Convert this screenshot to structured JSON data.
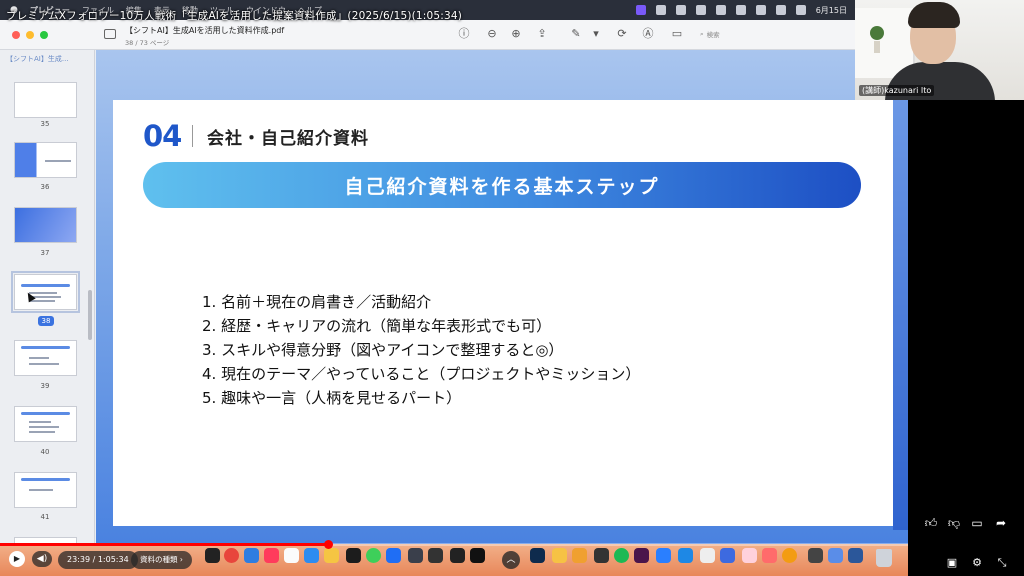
{
  "video": {
    "title": "プレミアムXフォロワー10万人戦術「生成AIを活用した提案資料作成」(2025/6/15)(1:05:34)",
    "current_time": "23:39",
    "duration": "1:05:34",
    "time_separator": " / ",
    "chapter_label": "資料の種類 ›",
    "progress_fraction": 0.361
  },
  "menubar": {
    "app": "プレビュー",
    "items": [
      "ファイル",
      "編集",
      "表示",
      "移動",
      "ツール",
      "ウインドウ",
      "ヘルプ"
    ],
    "clock": "6月15日"
  },
  "window": {
    "doc_title": "【シフトAI】生成AIを活用した資料作成.pdf",
    "page_indicator": "38 / 73 ページ",
    "search_placeholder": "検索",
    "traffic_colors": [
      "#ff5f57",
      "#febc2e",
      "#28c840"
    ]
  },
  "sidebar": {
    "header": "【シフトAI】生成...",
    "pages": [
      "35",
      "36",
      "37",
      "38",
      "39",
      "40",
      "41"
    ],
    "selected_page": "38"
  },
  "slide": {
    "number": "04",
    "heading": "会社・自己紹介資料",
    "banner": "自己紹介資料を作る基本ステップ",
    "steps": [
      "1. 名前＋現在の肩書き／活動紹介",
      "2. 経歴・キャリアの流れ（簡単な年表形式でも可）",
      "3. スキルや得意分野（図やアイコンで整理すると◎）",
      "4. 現在のテーマ／やっていること（プロジェクトやミッション）",
      "5. 趣味や一言（人柄を見せるパート）"
    ],
    "accent_color": "#1f57c9"
  },
  "webcam": {
    "name_tag": "(講師)kazunari Ito"
  },
  "colors": {
    "progress": "#ff0000",
    "dock_top": "#f2b089",
    "dock_bottom": "#e8875a"
  }
}
